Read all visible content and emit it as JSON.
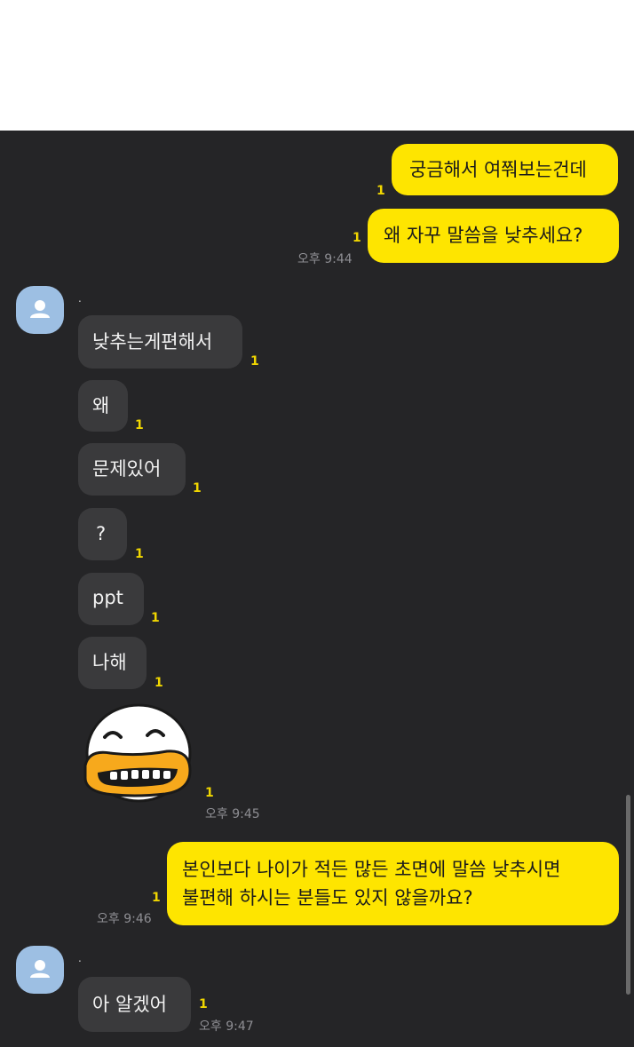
{
  "messages": {
    "out1": {
      "text": "궁금해서 여쭤보는건데",
      "unread": "1"
    },
    "out2": {
      "text": "왜 자꾸 말씀을 낮추세요?",
      "unread": "1",
      "time": "오후 9:44"
    },
    "in_sender": ".",
    "in1": {
      "text": "낮추는게편해서",
      "unread": "1"
    },
    "in2": {
      "text": "왜",
      "unread": "1"
    },
    "in3": {
      "text": "문제있어",
      "unread": "1"
    },
    "in4": {
      "text": "?",
      "unread": "1"
    },
    "in5": {
      "text": "ppt",
      "unread": "1"
    },
    "in6": {
      "text": "나해",
      "unread": "1"
    },
    "in7": {
      "sticker": "laughing-duck-sticker",
      "unread": "1",
      "time": "오후 9:45"
    },
    "out3": {
      "line1": "본인보다 나이가 적든 많든 초면에 말씀 낮추시면",
      "line2": "불편해 하시는 분들도 있지 않을까요?",
      "unread": "1",
      "time": "오후 9:46"
    },
    "in_sender2": ".",
    "in8": {
      "text": "아 알겠어",
      "unread": "1",
      "time": "오후 9:47"
    }
  },
  "colors": {
    "chat_bg": "#252527",
    "outgoing_bubble": "#FEE500",
    "incoming_bubble": "#3a3a3c",
    "unread_count": "#f0d600"
  }
}
